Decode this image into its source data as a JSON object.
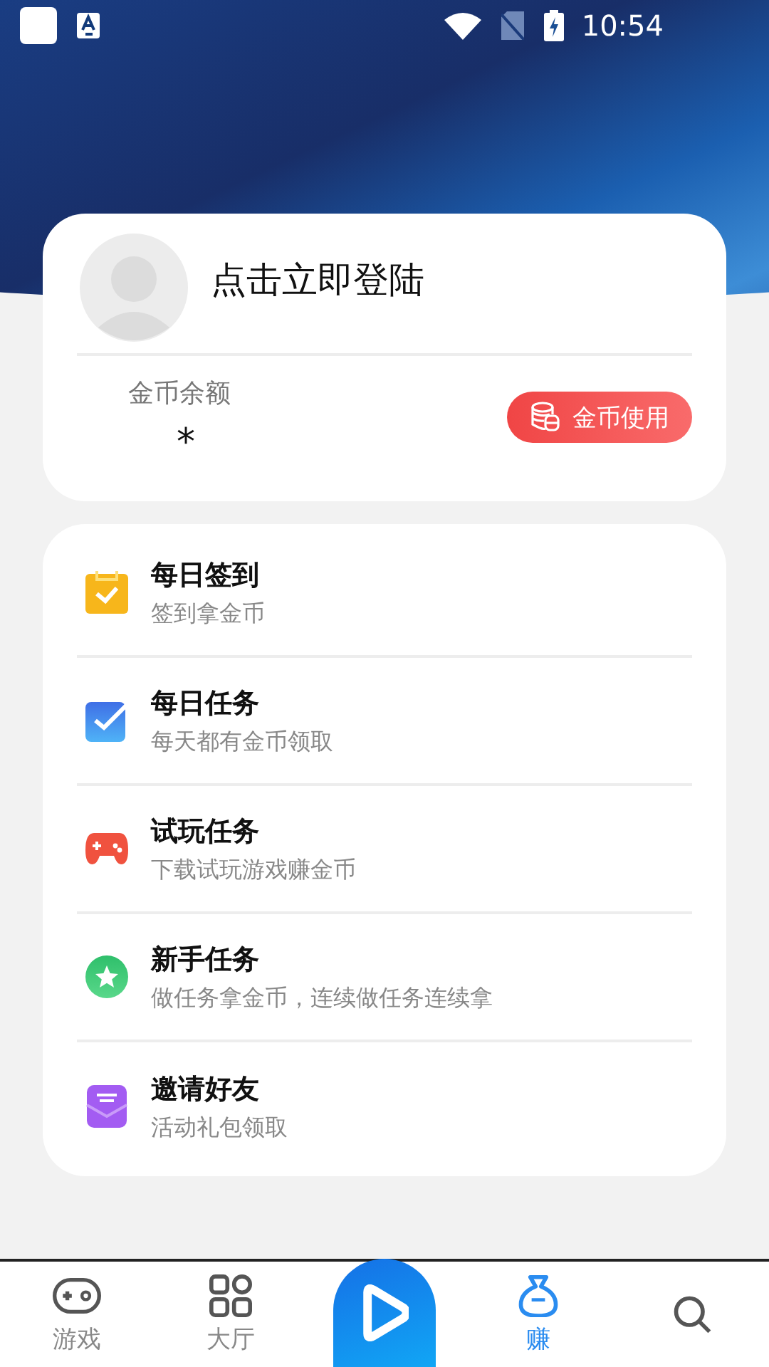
{
  "status_bar": {
    "time": "10:54"
  },
  "profile": {
    "login_prompt": "点击立即登陆",
    "balance_label": "金币余额",
    "balance_value": "*",
    "use_button": "金币使用"
  },
  "tasks": [
    {
      "kind": "calendar",
      "title": "每日签到",
      "subtitle": "签到拿金币"
    },
    {
      "kind": "check",
      "title": "每日任务",
      "subtitle": "每天都有金币领取"
    },
    {
      "kind": "gamepad",
      "title": "试玩任务",
      "subtitle": "下载试玩游戏赚金币"
    },
    {
      "kind": "star",
      "title": "新手任务",
      "subtitle": "做任务拿金币，连续做任务连续拿"
    },
    {
      "kind": "mail",
      "title": "邀请好友",
      "subtitle": "活动礼包领取"
    }
  ],
  "bottom_nav": [
    {
      "kind": "gamepad",
      "label": "游戏",
      "selected": false
    },
    {
      "kind": "grid",
      "label": "大厅",
      "selected": false
    },
    {
      "kind": "play",
      "selected": false
    },
    {
      "kind": "bag",
      "label": "赚",
      "selected": true
    },
    {
      "kind": "search",
      "selected": false
    }
  ]
}
